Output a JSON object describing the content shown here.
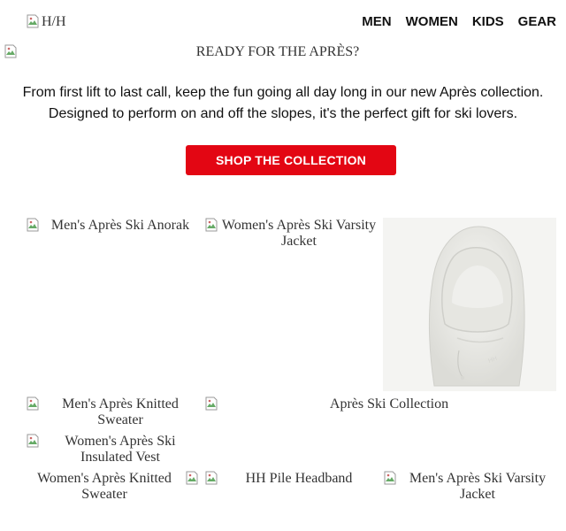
{
  "header": {
    "logo_alt": "H/H",
    "nav": [
      "MEN",
      "WOMEN",
      "KIDS",
      "GEAR"
    ]
  },
  "hero": {
    "image_alt": "READY FOR THE APRÈS?"
  },
  "intro": {
    "line1": "From first lift to last call, keep the fun going all day long in our new Après collection.",
    "line2": "Designed to perform on and off the slopes, it's the perfect gift for ski lovers."
  },
  "cta": {
    "label": "SHOP THE COLLECTION",
    "color": "#e30613"
  },
  "products": {
    "mens_anorak": "Men's Après Ski Anorak",
    "womens_varsity_jacket": "Women's Après Ski Varsity Jacket",
    "mens_knitted_sweater": "Men's Après Knitted Sweater",
    "apres_collection": "Après Ski Collection",
    "womens_insulated_vest": "Women's Après Ski Insulated Vest",
    "womens_knitted_sweater": "Women's Après Knitted Sweater",
    "pile_headband": "HH Pile Headband",
    "mens_varsity_jacket": "Men's Après Ski Varsity Jacket"
  }
}
